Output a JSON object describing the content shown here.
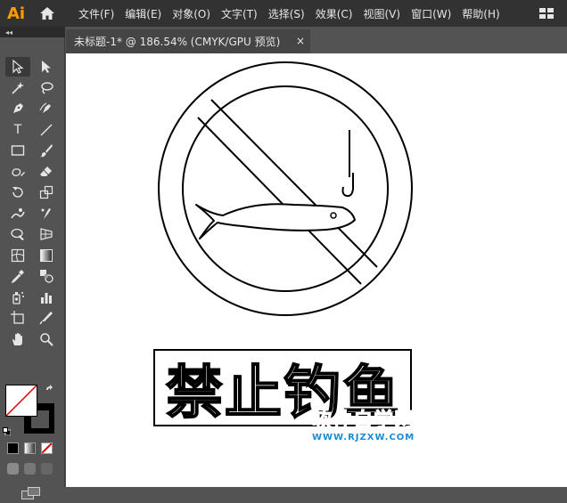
{
  "app": {
    "logo": "Ai"
  },
  "menubar": {
    "items": [
      "文件(F)",
      "编辑(E)",
      "对象(O)",
      "文字(T)",
      "选择(S)",
      "效果(C)",
      "视图(V)",
      "窗口(W)",
      "帮助(H)"
    ]
  },
  "document": {
    "tab_title": "未标题-1* @ 186.54% (CMYK/GPU 预览)",
    "close_glyph": "×"
  },
  "toolbar": {
    "collapse_glyph": "◂◂",
    "tools": [
      "selection-tool",
      "direct-selection-tool",
      "magic-wand-tool",
      "lasso-tool",
      "pen-tool",
      "curvature-tool",
      "type-tool",
      "line-segment-tool",
      "rectangle-tool",
      "paintbrush-tool",
      "shaper-tool",
      "eraser-tool",
      "rotate-tool",
      "scale-tool",
      "warp-tool",
      "puppet-warp-tool",
      "shape-builder-tool",
      "perspective-grid-tool",
      "mesh-tool",
      "gradient-tool",
      "eyedropper-tool",
      "blend-tool",
      "symbol-sprayer-tool",
      "column-graph-tool",
      "artboard-tool",
      "slice-tool",
      "hand-tool",
      "zoom-tool"
    ],
    "type_glyph": "T"
  },
  "artwork": {
    "sign_text": "禁止钓鱼",
    "stroke_color": "#000000",
    "fill_color": "#ffffff"
  },
  "watermark": {
    "title": "软件自学网",
    "url": "WWW.RJZXW.COM",
    "color": "#1c8bd6"
  }
}
